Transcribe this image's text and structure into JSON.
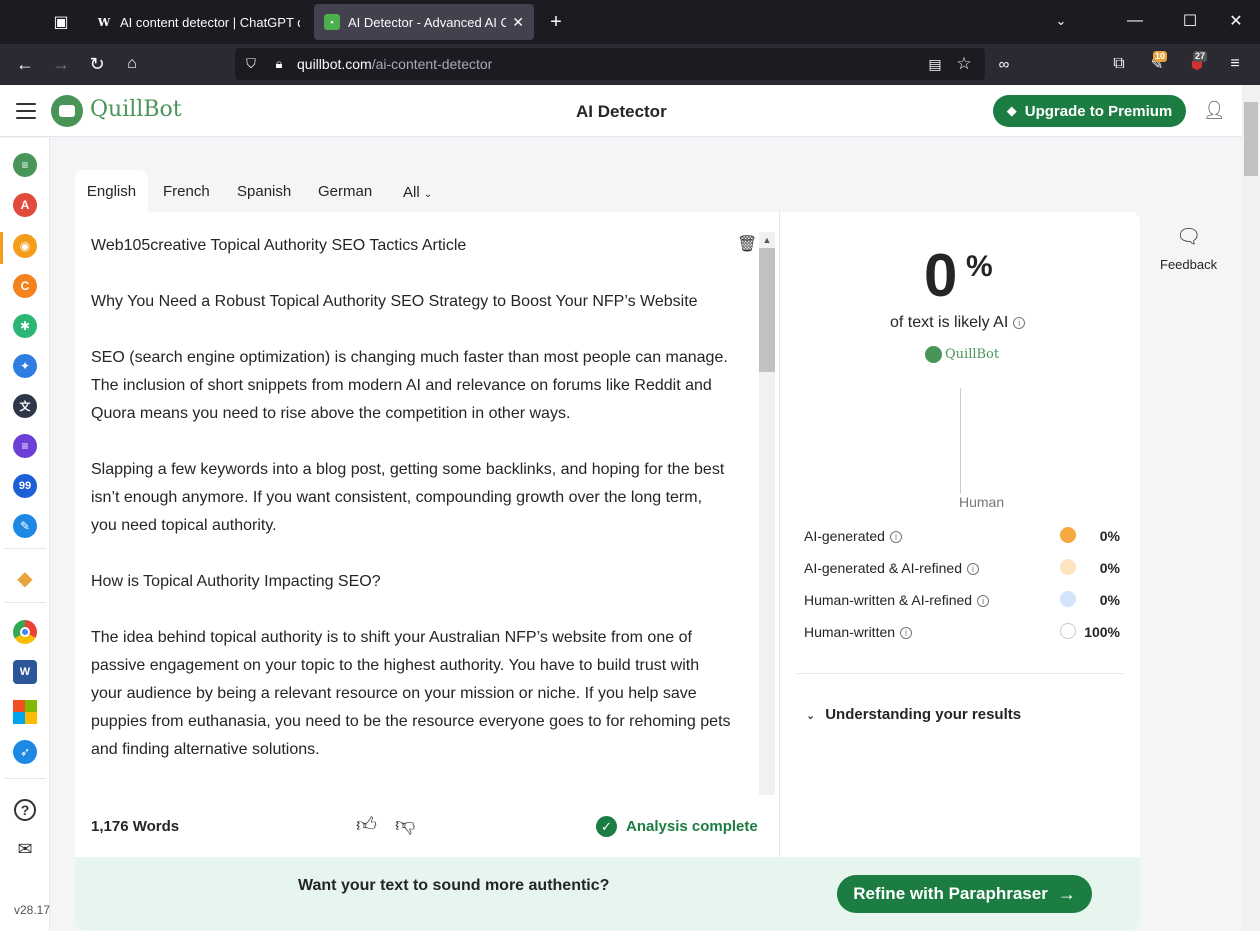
{
  "browser": {
    "tabs": [
      {
        "title": "AI content detector | ChatGPT detector",
        "favicon": "W",
        "active": false
      },
      {
        "title": "AI Detector - Advanced AI Checker",
        "favicon": "Q",
        "active": true
      }
    ],
    "new_tab": "+",
    "url_host": "quillbot.com",
    "url_path": "/ai-content-detector",
    "badges": {
      "ext1": "10",
      "ext2": "27"
    }
  },
  "header": {
    "logo_text": "QuillBot",
    "title": "AI Detector",
    "upgrade_label": "Upgrade to Premium"
  },
  "sidebar": {
    "icons": [
      {
        "name": "paraphraser-icon",
        "color": "#499557",
        "glyph": "≡"
      },
      {
        "name": "grammar-checker-icon",
        "color": "#e24a3b",
        "glyph": "A"
      },
      {
        "name": "ai-detector-icon",
        "color": "#f59c1a",
        "glyph": "◉"
      },
      {
        "name": "plagiarism-checker-icon",
        "color": "#f5821f",
        "glyph": "C"
      },
      {
        "name": "ai-humanizer-icon",
        "color": "#2bb673",
        "glyph": "✱"
      },
      {
        "name": "ai-chat-icon",
        "color": "#2e7de1",
        "glyph": "✦"
      },
      {
        "name": "translator-icon",
        "color": "#2d3748",
        "glyph": "文"
      },
      {
        "name": "summarizer-icon",
        "color": "#6c3fd6",
        "glyph": "≡"
      },
      {
        "name": "citation-generator-icon",
        "color": "#1d5fd6",
        "glyph": "99"
      },
      {
        "name": "co-writer-icon",
        "color": "#1e88e5",
        "glyph": "✎"
      }
    ],
    "version": "v28.17"
  },
  "languages": {
    "tabs": [
      "English",
      "French",
      "Spanish",
      "German"
    ],
    "all_label": "All",
    "active": "English"
  },
  "editor": {
    "paragraphs": [
      "Web105creative Topical Authority SEO Tactics Article",
      "Why You Need a Robust Topical Authority SEO Strategy to Boost Your NFP’s Website",
      "SEO (search engine optimization) is changing much faster than most people can manage. The inclusion of short snippets from modern AI and relevance on forums like Reddit and Quora means you need to rise above the competition in other ways.",
      "Slapping a few keywords into a blog post, getting some backlinks, and hoping for the best isn’t enough anymore. If you want consistent, compounding growth over the long term, you need topical authority.",
      "How is Topical Authority Impacting SEO?",
      "The idea behind topical authority is to shift your Australian NFP’s website from one of passive engagement on your topic to the highest authority. You have to build trust with your audience by being a relevant resource on your mission or niche. If you help save puppies from euthanasia, you need to be the resource everyone goes to for rehoming pets and finding alternative solutions."
    ],
    "word_count": "1,176 Words",
    "status": "Analysis complete"
  },
  "results": {
    "ai_percent": "0",
    "percent_sign": "%",
    "likely_label": "of text is likely AI",
    "logo_text": "QuillBot",
    "gauge_label": "Human",
    "rows": [
      {
        "label": "AI-generated",
        "value": "0%",
        "color": "#f5a940"
      },
      {
        "label": "AI-generated & AI-refined",
        "value": "0%",
        "color": "#fde3c0"
      },
      {
        "label": "Human-written & AI-refined",
        "value": "0%",
        "color": "#d4e4fb"
      },
      {
        "label": "Human-written",
        "value": "100%",
        "color": "#ffffff"
      }
    ],
    "understanding_label": "Understanding your results"
  },
  "feedback_label": "Feedback",
  "promo": {
    "text": "Want your text to sound more authentic?",
    "button_label": "Refine with Paraphraser"
  }
}
